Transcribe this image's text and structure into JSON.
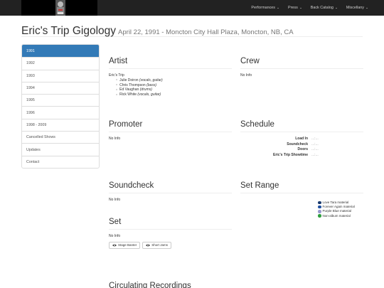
{
  "navbar": {
    "logo_icon": "band-logo-image",
    "menu": [
      {
        "label": "Performances"
      },
      {
        "label": "Press"
      },
      {
        "label": "Back Catalog"
      },
      {
        "label": "Miscellany"
      }
    ]
  },
  "header": {
    "title": "Eric's Trip Gigology",
    "subtitle": "April 22, 1991 - Moncton City Hall Plaza, Moncton, NB, CA"
  },
  "sidebar": {
    "active_color": "#337ab7",
    "items": [
      {
        "label": "1991",
        "active": true
      },
      {
        "label": "1992"
      },
      {
        "label": "1993"
      },
      {
        "label": "1994"
      },
      {
        "label": "1995"
      },
      {
        "label": "1996"
      },
      {
        "label": "1998 - 2009"
      },
      {
        "label": "Cancelled Shows"
      },
      {
        "label": "Updates"
      },
      {
        "label": "Contact"
      }
    ]
  },
  "artist": {
    "heading": "Artist",
    "name": "Eric's Trip",
    "members": [
      {
        "name": "Julie Doiron",
        "role": "(vocals, guitar)"
      },
      {
        "name": "Chris Thompson",
        "role": "(bass)"
      },
      {
        "name": "Ed Vaughan",
        "role": "(drums)"
      },
      {
        "name": "Rick White",
        "role": "(vocals, guitar)"
      }
    ]
  },
  "crew": {
    "heading": "Crew",
    "text": "No Info"
  },
  "promoter": {
    "heading": "Promoter",
    "text": "No Info"
  },
  "schedule": {
    "heading": "Schedule",
    "rows": [
      {
        "label": "Load In",
        "value": "...:..."
      },
      {
        "label": "Soundcheck",
        "value": "...:..."
      },
      {
        "label": "Doors",
        "value": "...:..."
      },
      {
        "label": "Eric's Trip Showtime",
        "value": "...:..."
      }
    ]
  },
  "soundcheck": {
    "heading": "Soundcheck",
    "text": "No Info"
  },
  "set_range": {
    "heading": "Set Range",
    "legend": [
      {
        "label": "Love Tara material",
        "color": "#1a3a6e"
      },
      {
        "label": "Forever Again material",
        "color": "#1f4fa0"
      },
      {
        "label": "Purple Blue material",
        "color": "#9a9ad0"
      },
      {
        "label": "Non-album material",
        "color": "#2e9e3e"
      }
    ]
  },
  "set": {
    "heading": "Set",
    "text": "No Info",
    "buttons": [
      {
        "label": "Stage Banter",
        "icon": "eye-icon"
      },
      {
        "label": "Short Jams",
        "icon": "eye-icon"
      }
    ]
  },
  "circulating": {
    "heading": "Circulating Recordings"
  }
}
